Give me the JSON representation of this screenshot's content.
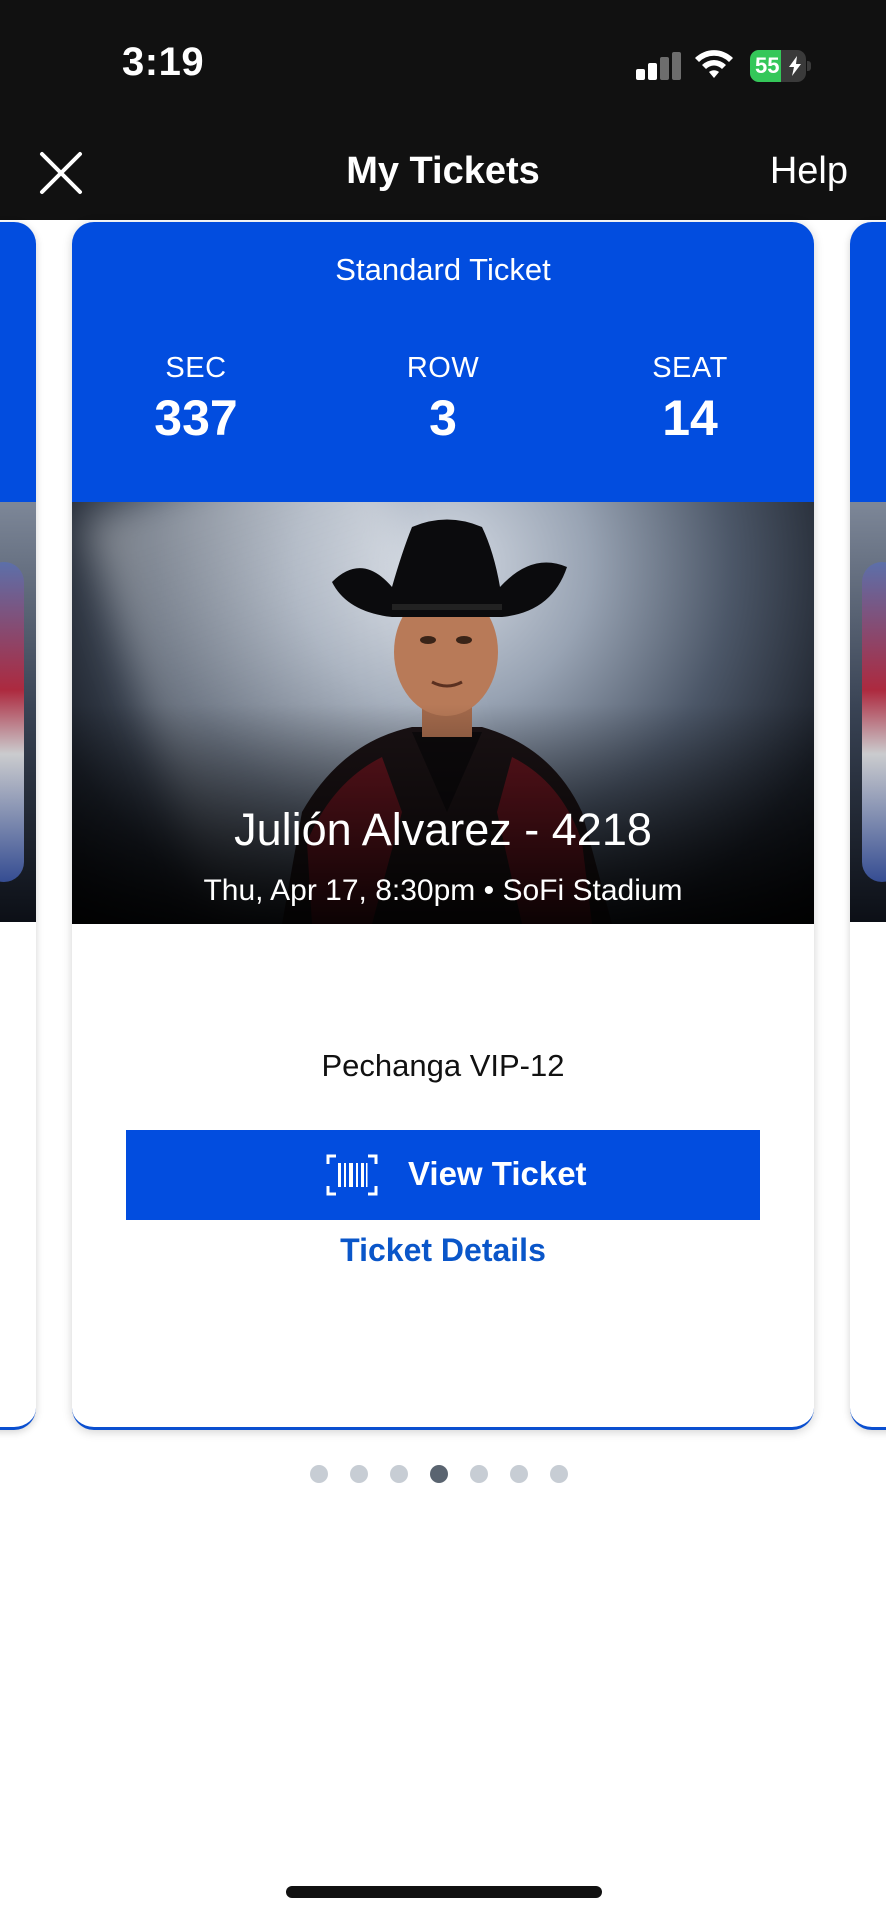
{
  "status_bar": {
    "time": "3:19",
    "battery_level": "55",
    "battery_fraction": 0.55,
    "battery_color": "#34c759",
    "icons": [
      "signal-icon",
      "wifi-icon",
      "battery-charging-icon"
    ]
  },
  "nav": {
    "close_icon": "close-icon",
    "title": "My Tickets",
    "help_label": "Help"
  },
  "ticket": {
    "type": "Standard Ticket",
    "sec_label": "SEC",
    "sec_value": "337",
    "row_label": "ROW",
    "row_value": "3",
    "seat_label": "SEAT",
    "seat_value": "14",
    "event_name": "Julión Alvarez - 4218",
    "event_meta": "Thu, Apr 17, 8:30pm • SoFi Stadium",
    "section_name": "Pechanga VIP-12",
    "view_ticket_label": "View Ticket",
    "view_ticket_icon": "barcode-scan-icon",
    "details_label": "Ticket Details",
    "brand_color": "#024ddf"
  },
  "pager": {
    "total": 7,
    "active_index": 3
  }
}
